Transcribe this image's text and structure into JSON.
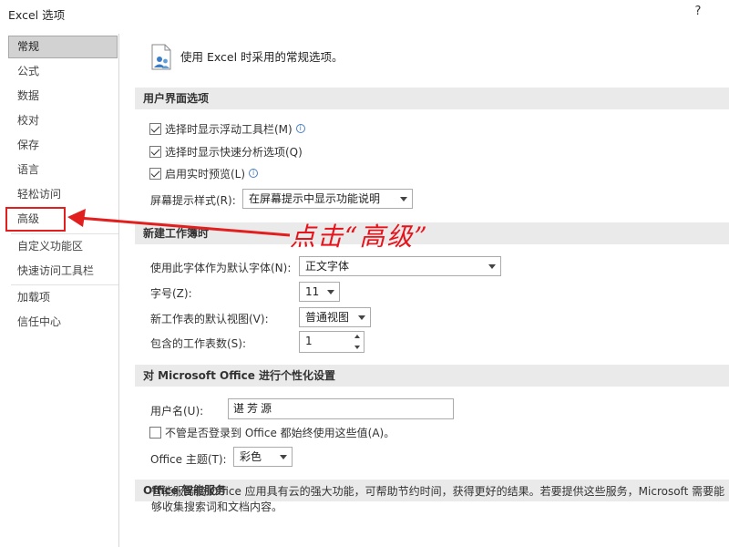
{
  "window": {
    "title": "Excel 选项",
    "help_label": "?"
  },
  "nav": {
    "items": [
      {
        "label": "常规",
        "selected": true
      },
      {
        "label": "公式"
      },
      {
        "label": "数据"
      },
      {
        "label": "校对"
      },
      {
        "label": "保存"
      },
      {
        "label": "语言"
      },
      {
        "label": "轻松访问"
      },
      {
        "label": "高级"
      },
      {
        "label": "自定义功能区"
      },
      {
        "label": "快速访问工具栏"
      },
      {
        "label": "加载项"
      },
      {
        "label": "信任中心"
      }
    ]
  },
  "intro": {
    "text": "使用 Excel 时采用的常规选项。",
    "icon": "general-options-icon"
  },
  "ui_options": {
    "header": "用户界面选项",
    "mini_toolbar": {
      "label": "选择时显示浮动工具栏(M)",
      "checked": true
    },
    "quick_analysis": {
      "label": "选择时显示快速分析选项(Q)",
      "checked": true
    },
    "live_preview": {
      "label": "启用实时预览(L)",
      "checked": true
    },
    "screentip": {
      "label": "屏幕提示样式(R):",
      "value": "在屏幕提示中显示功能说明"
    }
  },
  "new_workbook": {
    "header": "新建工作簿时",
    "font": {
      "label": "使用此字体作为默认字体(N):",
      "value": "正文字体"
    },
    "font_size": {
      "label": "字号(Z):",
      "value": "11"
    },
    "default_view": {
      "label": "新工作表的默认视图(V):",
      "value": "普通视图"
    },
    "sheet_count": {
      "label": "包含的工作表数(S):",
      "value": "1"
    }
  },
  "personalize": {
    "header": "对 Microsoft Office 进行个性化设置",
    "username": {
      "label": "用户名(U):",
      "value": "谌芳源"
    },
    "always_use": {
      "label": "不管是否登录到 Office 都始终使用这些值(A)。",
      "checked": false
    },
    "theme": {
      "label": "Office 主题(T):",
      "value": "彩色"
    }
  },
  "intelligent": {
    "header": "Office 智能服务",
    "description": "智能服务使 Office 应用具有云的强大功能，可帮助节约时间，获得更好的结果。若要提供这些服务，Microsoft 需要能够收集搜索词和文档内容。"
  },
  "annotation": {
    "text": "点击“高级”",
    "color": "#e8121b"
  },
  "colors": {
    "accent_red": "#e21f1f",
    "selected_nav": "#d2d2d2",
    "section_bg": "#eaeaea"
  }
}
